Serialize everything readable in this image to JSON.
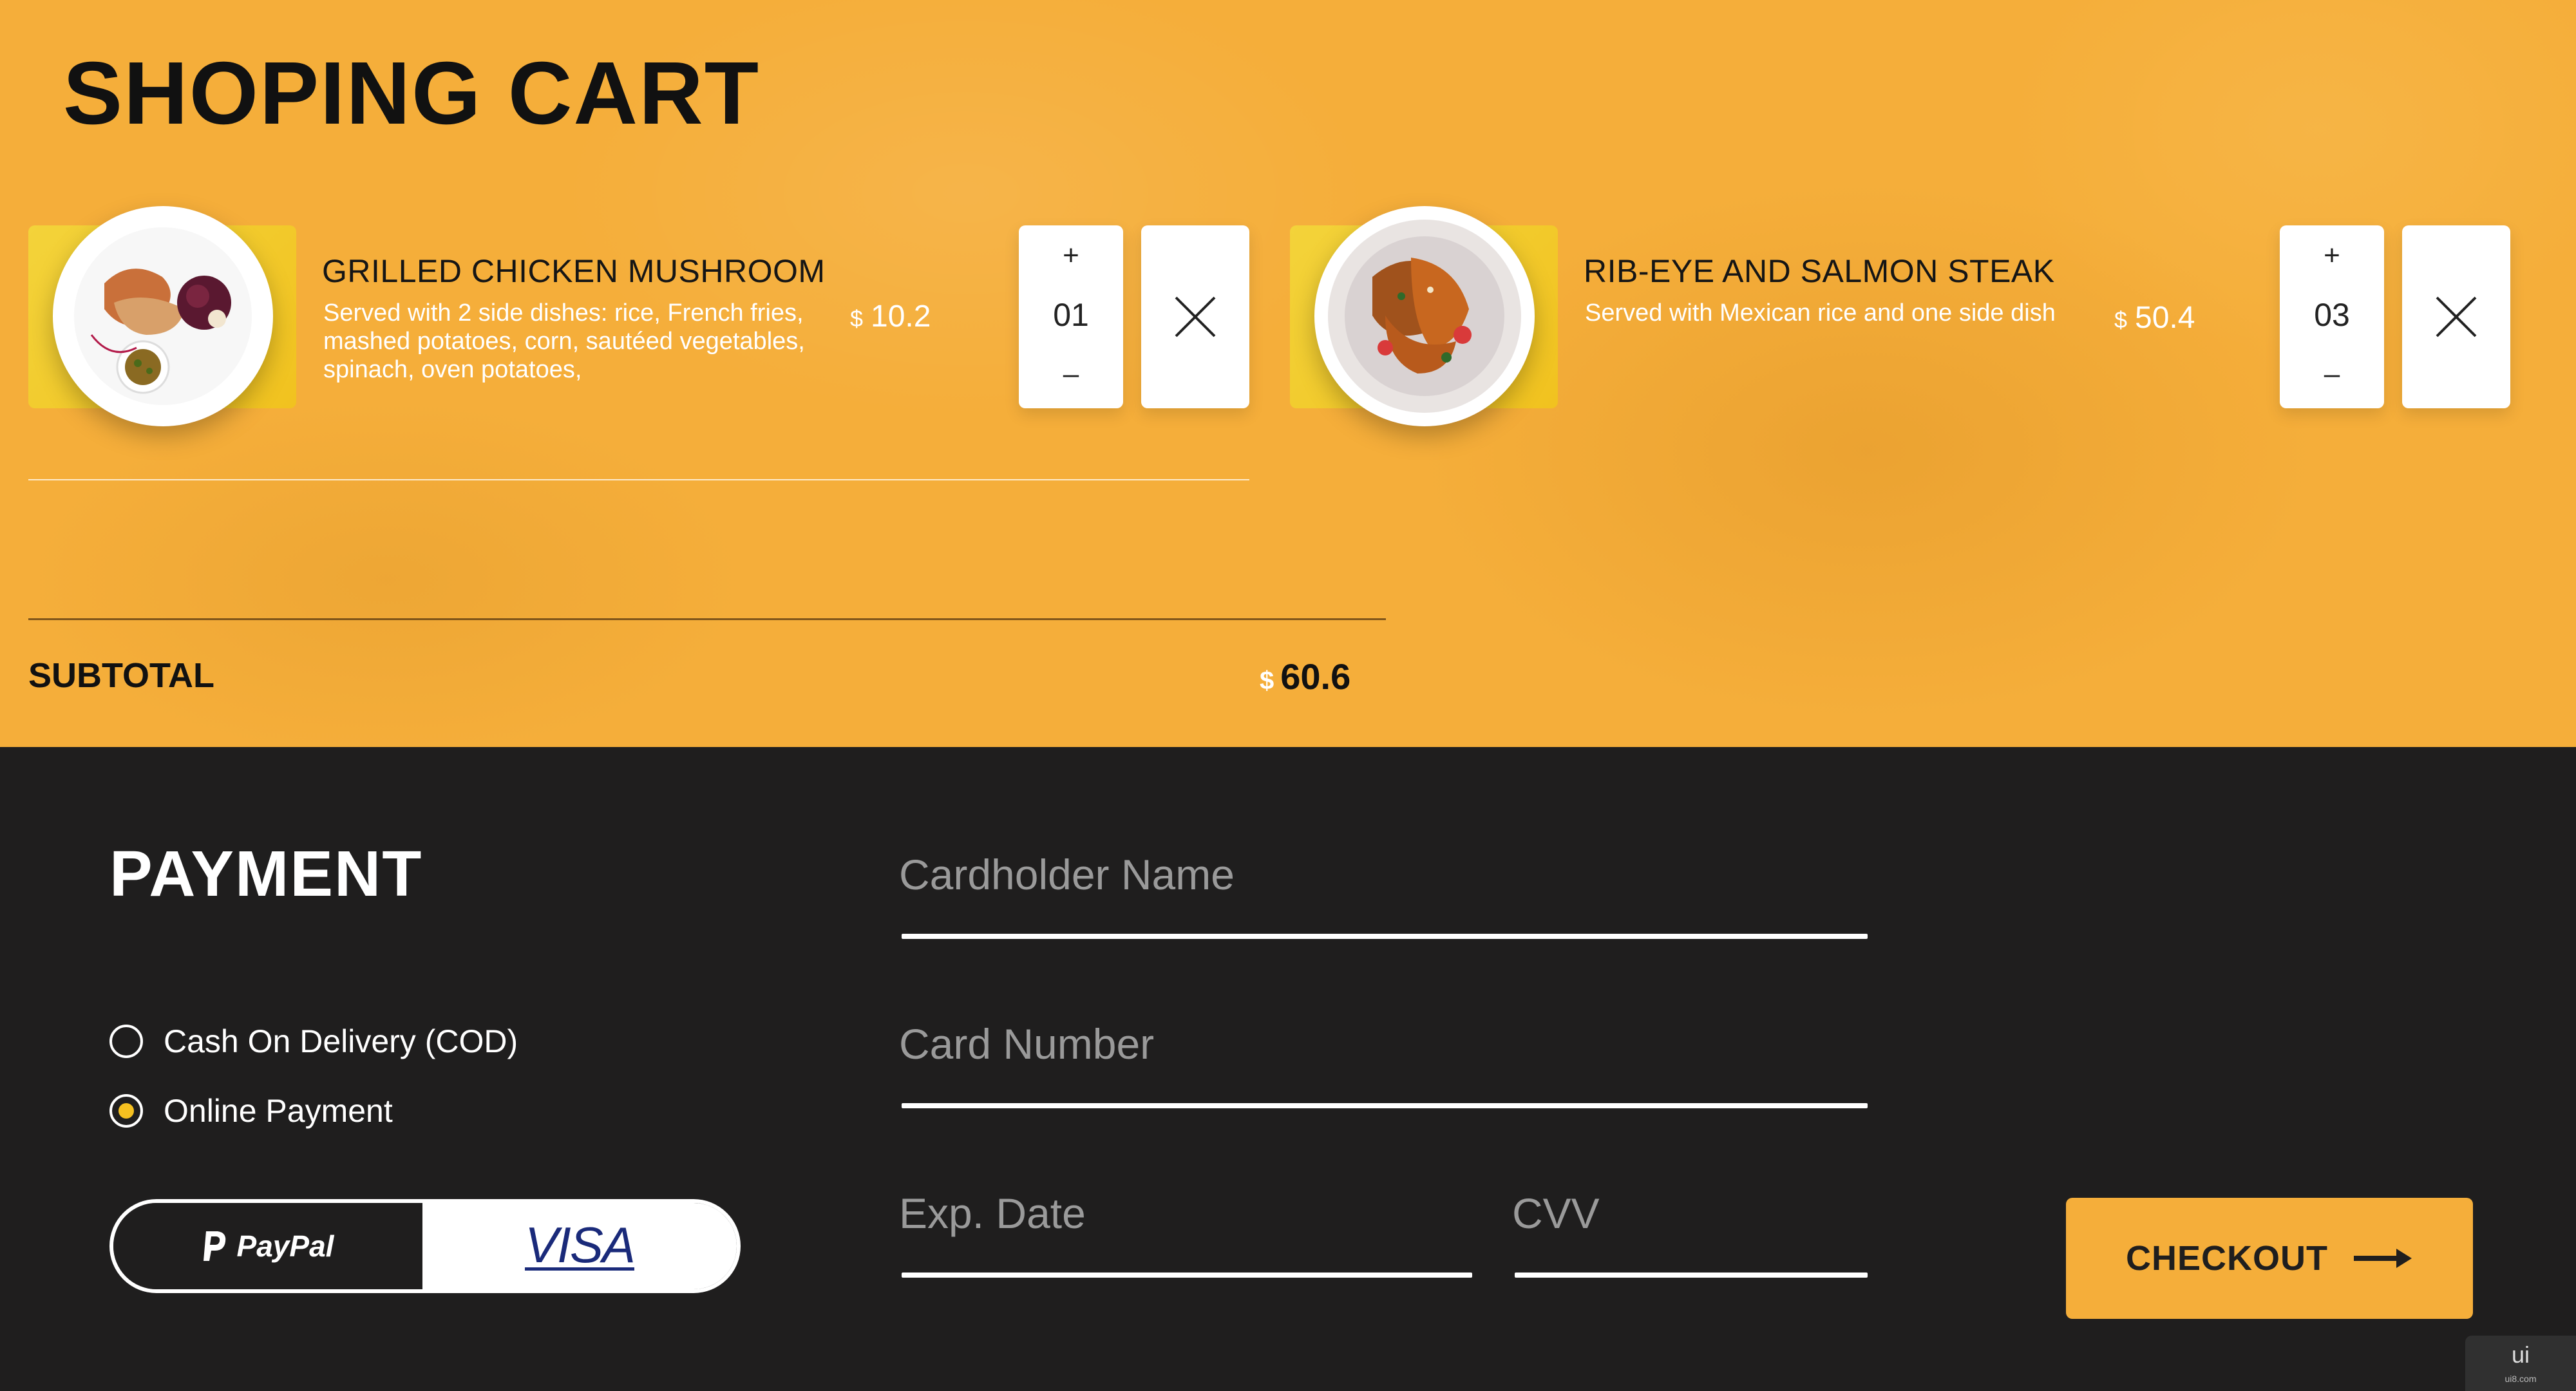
{
  "cart": {
    "title": "SHOPING CART",
    "items": [
      {
        "name": "GRILLED CHICKEN MUSHROOM",
        "description": "Served with 2 side dishes: rice, French fries, mashed potatoes, corn, sautéed vegetables, spinach, oven potatoes,",
        "currency": "$",
        "price": "10.2",
        "quantity": "01",
        "plus": "+",
        "minus": "–"
      },
      {
        "name": "RIB-EYE AND SALMON STEAK",
        "description": "Served with Mexican rice and one side dish",
        "currency": "$",
        "price": "50.4",
        "quantity": "03",
        "plus": "+",
        "minus": "–"
      }
    ],
    "subtotal_label": "SUBTOTAL",
    "subtotal_currency": "$",
    "subtotal_value": "60.6"
  },
  "payment": {
    "title": "PAYMENT",
    "options": [
      {
        "label": "Cash On Delivery (COD)",
        "selected": false
      },
      {
        "label": "Online Payment",
        "selected": true
      }
    ],
    "methods": {
      "paypal": "PayPal",
      "visa": "VISA"
    },
    "fields": {
      "cardholder_placeholder": "Cardholder Name",
      "card_number_placeholder": "Card Number",
      "exp_placeholder": "Exp. Date",
      "cvv_placeholder": "CVV"
    },
    "checkout_label": "CHECKOUT"
  },
  "watermark": {
    "text": "ui",
    "sub": "ui8.com"
  },
  "colors": {
    "accent_orange": "#f5ae3a",
    "card_yellow": "#f1c21f",
    "dark_bg": "#1f1e1e",
    "radio_selected": "#f5c020",
    "visa_blue": "#1a2a7a"
  },
  "icons": {
    "remove": "close-x-icon",
    "checkout": "arrow-right-icon",
    "paypal": "paypal-logo-icon"
  }
}
